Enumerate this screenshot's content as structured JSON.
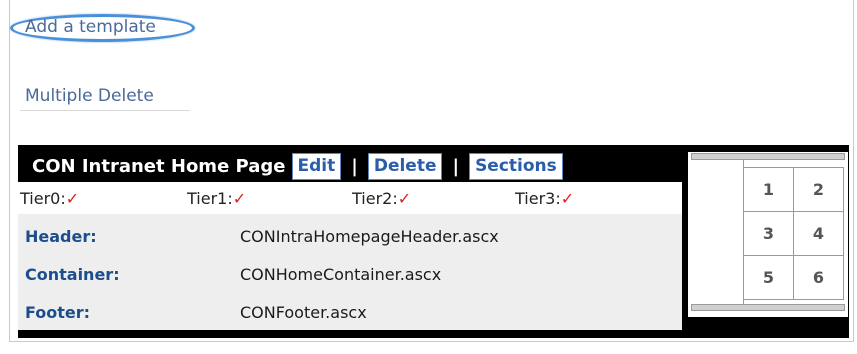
{
  "links": {
    "add_template": "Add a template",
    "multiple_delete": "Multiple Delete"
  },
  "template": {
    "title": "CON Intranet Home Page",
    "edit": "Edit",
    "delete": "Delete",
    "sections": "Sections",
    "separator": "|",
    "tiers": [
      {
        "label": "Tier0:",
        "check": "✓"
      },
      {
        "label": "Tier1:",
        "check": "✓"
      },
      {
        "label": "Tier2:",
        "check": "✓"
      },
      {
        "label": "Tier3:",
        "check": "✓"
      }
    ],
    "rows": [
      {
        "key": "Header:",
        "value": "CONIntraHomepageHeader.ascx"
      },
      {
        "key": "Container:",
        "value": "CONHomeContainer.ascx"
      },
      {
        "key": "Footer:",
        "value": "CONFooter.ascx"
      }
    ],
    "sections_grid": [
      "1",
      "2",
      "3",
      "4",
      "5",
      "6"
    ]
  }
}
